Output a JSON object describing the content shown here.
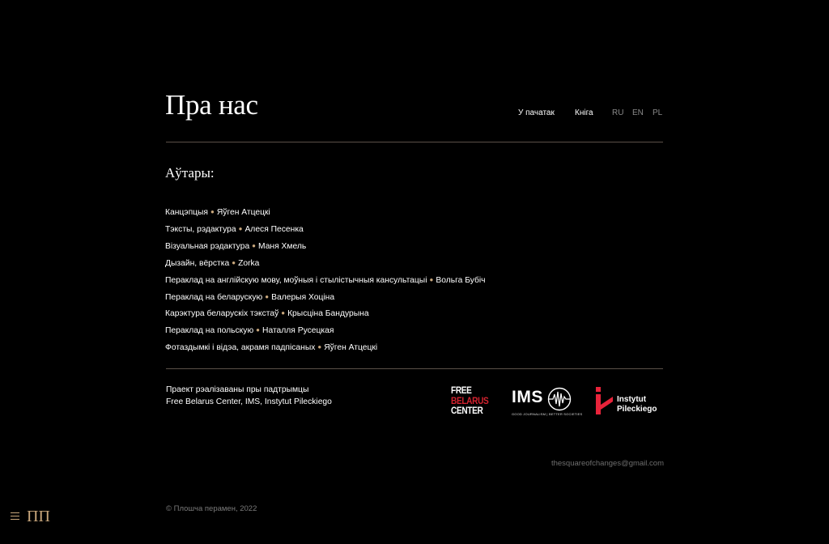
{
  "header": {
    "title": "Пра нас",
    "nav": [
      {
        "label": "У пачатак"
      },
      {
        "label": "Кніга"
      }
    ],
    "languages": [
      "RU",
      "EN",
      "PL"
    ]
  },
  "authors": {
    "heading": "Аўтары:",
    "credits": [
      {
        "role": "Канцэпцыя",
        "name": "Яўген Атцецкі"
      },
      {
        "role": "Тэксты, рэдактура",
        "name": "Алеся Песенка"
      },
      {
        "role": "Візуальная рэдактура",
        "name": "Маня Хмель"
      },
      {
        "role": "Дызайн, вёрстка",
        "name": "Zorka"
      },
      {
        "role": "Пераклад на англійскую мову, моўныя і стылістычныя кансультацыі",
        "name": "Вольга Бубіч"
      },
      {
        "role": "Пераклад на беларускую",
        "name": "Валерыя Хоціна"
      },
      {
        "role": "Карэктура беларускіх тэкстаў",
        "name": "Крысціна Бандурына"
      },
      {
        "role": "Пераклад на польскую",
        "name": "Наталля Русецкая"
      },
      {
        "role": "Фотаздымкі і відэа, акрамя падпісаных",
        "name": "Яўген Атцецкі"
      }
    ],
    "separator": "●"
  },
  "support": {
    "line1": "Праект рэалізаваны пры падтрымцы",
    "line2": "Free Belarus Center, IMS, Instytut Pileckiego"
  },
  "logos": {
    "fbc": [
      "FREE",
      "BELARUS",
      "CENTER"
    ],
    "ims": {
      "name": "IMS",
      "tagline": "GOOD JOURNALISM | BETTER SOCIETIES"
    },
    "pilecki": [
      "Instytut",
      "Pileckiego"
    ]
  },
  "colors": {
    "background": "#000000",
    "accent": "#c9a77c",
    "fbc_red": "#d4222f",
    "pilecki_red": "#e8233a"
  },
  "footer": {
    "email": "thesquareofchanges@gmail.com",
    "copyright": "© Плошча перамен, 2022",
    "mark": "ПП",
    "menu_icon": "hamburger-icon"
  }
}
